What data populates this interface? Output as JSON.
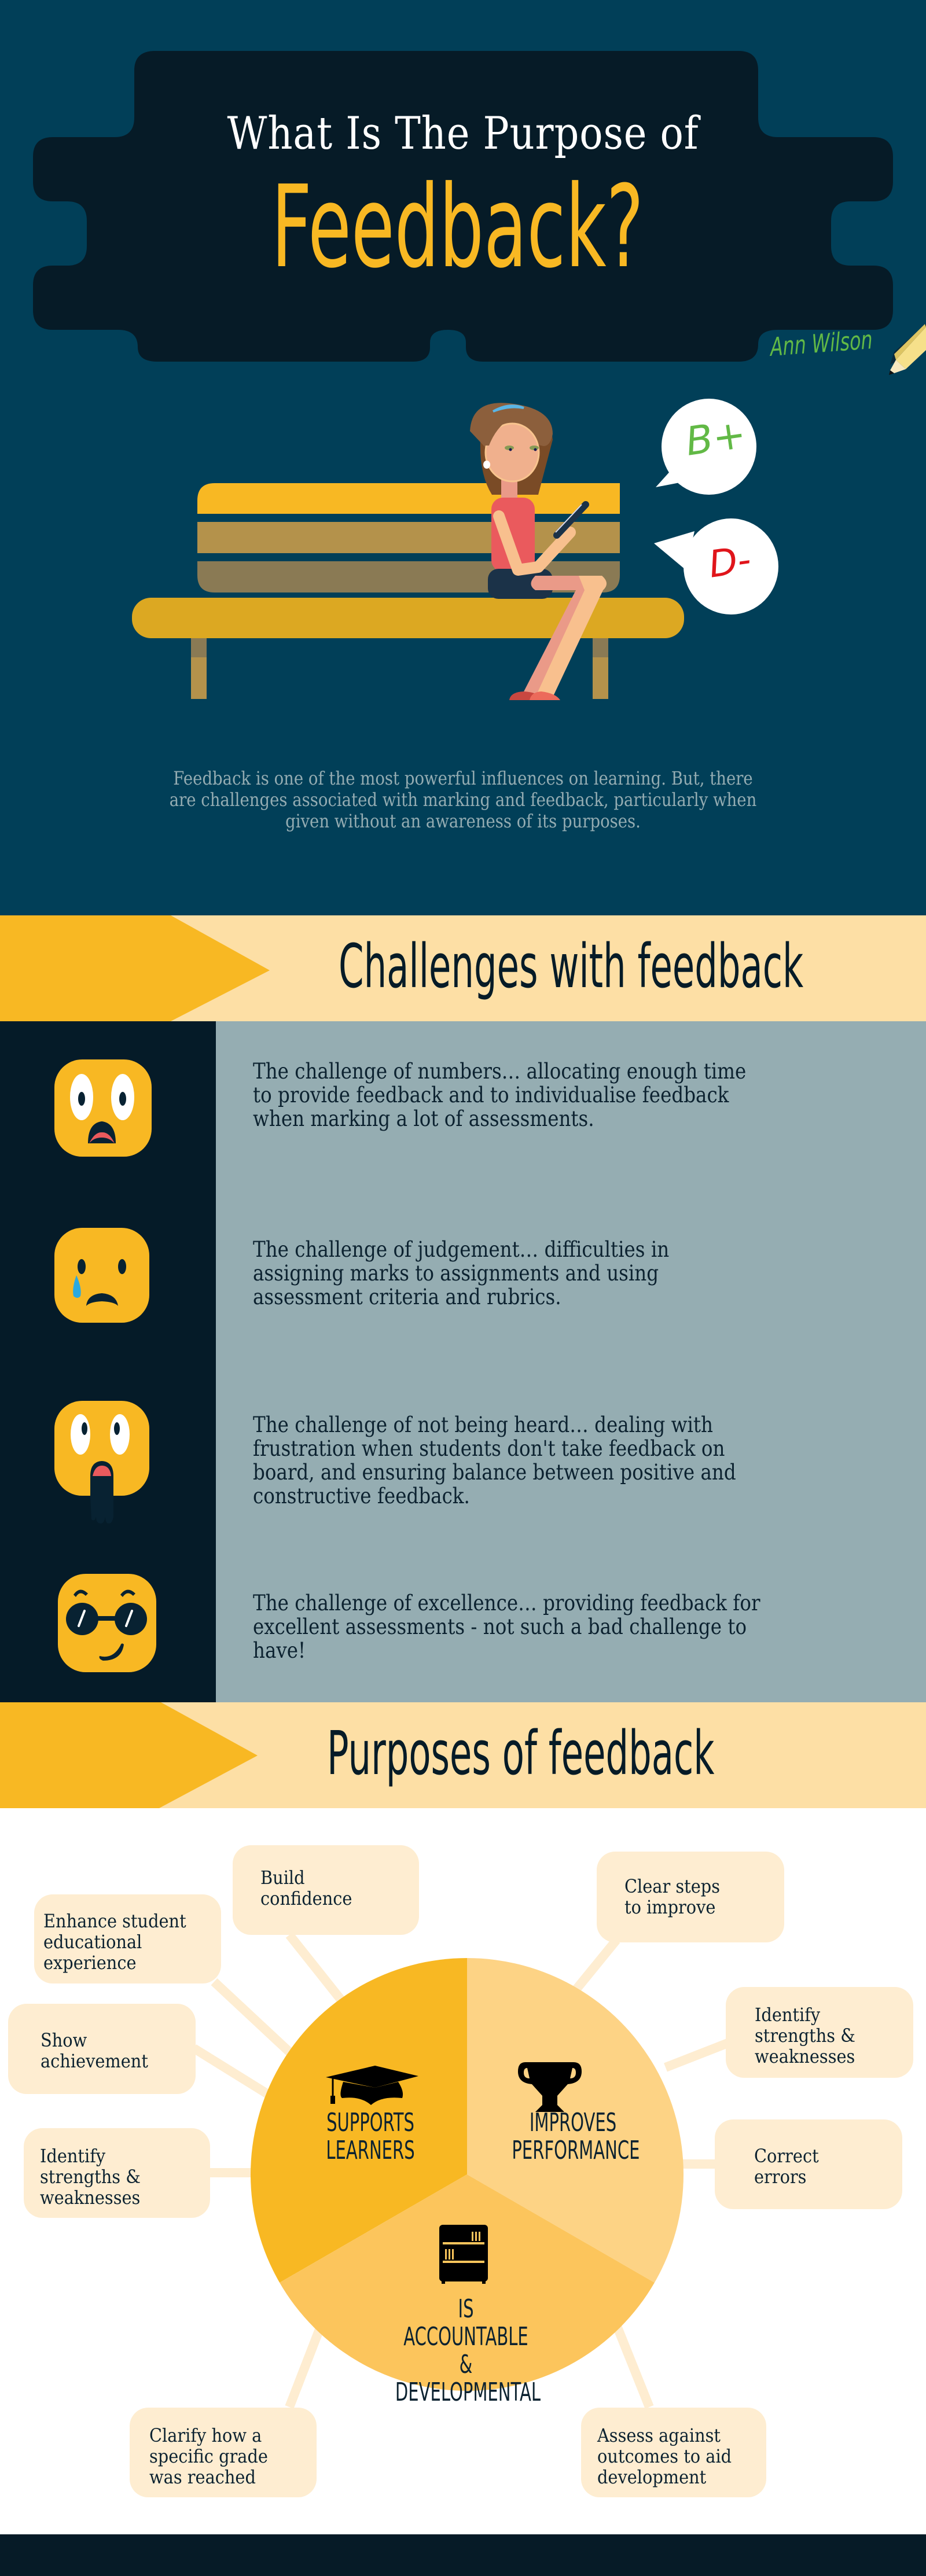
{
  "header": {
    "title_line1": "What Is The Purpose of",
    "title_line2": "Feedback?",
    "author": "Ann Wilson",
    "pencil_icon": "pencil-icon"
  },
  "illustration": {
    "description": "woman-on-bench-with-phone",
    "bubbles": [
      {
        "grade": "B+",
        "color": "#62b946"
      },
      {
        "grade": "D-",
        "color": "#e0151b"
      }
    ]
  },
  "intro": {
    "text": "Feedback is one of the most powerful influences on learning. But, there are challenges associated with marking and feedback, particularly when given without an awareness of its purposes."
  },
  "challenges": {
    "heading": "Challenges with feedback",
    "items": [
      {
        "icon": "shocked-face-icon",
        "text": "The challenge of numbers… allocating enough time to provide feedback and to individualise feedback when marking a lot of assessments."
      },
      {
        "icon": "crying-face-icon",
        "text": "The challenge of judgement… difficulties in assigning marks to assignments and using assessment criteria and rubrics."
      },
      {
        "icon": "drooling-face-icon",
        "text": "The challenge of not being heard… dealing with frustration when students don't take feedback on board, and ensuring balance between positive and constructive feedback."
      },
      {
        "icon": "sunglasses-face-icon",
        "text": "The challenge of excellence… providing feedback for excellent assessments - not such a bad challenge to have!"
      }
    ]
  },
  "purposes": {
    "heading": "Purposes of feedback",
    "segments": [
      {
        "label": "SUPPORTS\nLEARNERS",
        "icon": "graduation-cap-icon",
        "color": "#f8b823"
      },
      {
        "label": "IMPROVES\nPERFORMANCE",
        "icon": "trophy-icon",
        "color": "#fdd385"
      },
      {
        "label": "IS ACCOUNTABLE &\nDEVELOPMENTAL",
        "icon": "bookshelf-icon",
        "color": "#fcc55c"
      }
    ],
    "boxes": [
      {
        "segment": "SUPPORTS LEARNERS",
        "text": "Build\nconfidence"
      },
      {
        "segment": "SUPPORTS LEARNERS",
        "text": "Enhance student\neducational\nexperience"
      },
      {
        "segment": "SUPPORTS LEARNERS",
        "text": "Show\nachievement"
      },
      {
        "segment": "SUPPORTS LEARNERS",
        "text": "Identify\nstrengths &\nweaknesses"
      },
      {
        "segment": "IMPROVES PERFORMANCE",
        "text": "Clear steps\nto improve"
      },
      {
        "segment": "IMPROVES PERFORMANCE",
        "text": "Identify\nstrengths &\nweaknesses"
      },
      {
        "segment": "IMPROVES PERFORMANCE",
        "text": "Correct\nerrors"
      },
      {
        "segment": "IS ACCOUNTABLE & DEVELOPMENTAL",
        "text": "Clarify how a\nspecific grade\nwas reached"
      },
      {
        "segment": "IS ACCOUNTABLE & DEVELOPMENTAL",
        "text": "Assess against\noutcomes to aid\ndevelopment"
      }
    ]
  },
  "colors": {
    "navy": "#013f58",
    "dark": "#061b27",
    "accent_yellow": "#f8b823",
    "banner_cream": "#fddfa5",
    "slate": "#95adb2",
    "box_cream": "#feedd1",
    "signature_green": "#62b946"
  }
}
